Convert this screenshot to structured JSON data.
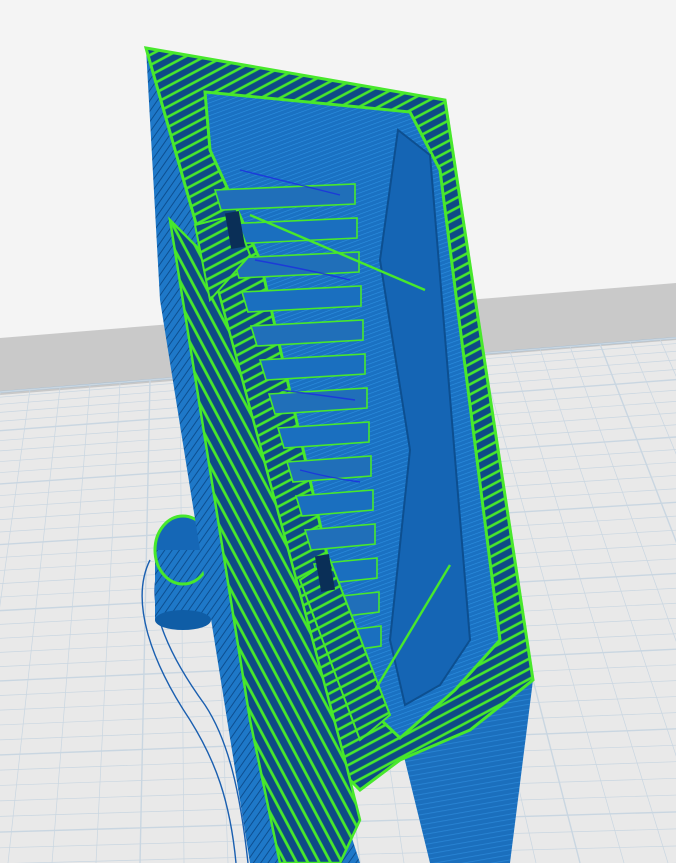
{
  "viewport": {
    "view": "layer-preview",
    "colors": {
      "background": "#f4f4f4",
      "wall": "#c4c4c4",
      "plate": "#e9e9e9",
      "grid_line": "#c9d6e1",
      "plate_edge": "#9fb9cf",
      "model_outer": "#0f5da6",
      "model_shell": "#1e78c8",
      "infill_green": "#48e82c",
      "infill_gap": "#0b3f73",
      "travel_blue": "#1b2de0",
      "skirt": "#1a5fb0"
    },
    "layers": [
      {
        "feature": "outer-wall",
        "color": "#0f5da6"
      },
      {
        "feature": "inner-wall",
        "color": "#48e82c"
      },
      {
        "feature": "infill",
        "color": "#48e82c"
      },
      {
        "feature": "skin",
        "color": "#1e78c8"
      },
      {
        "feature": "travel",
        "color": "#1b2de0"
      },
      {
        "feature": "skirt",
        "color": "#1a5fb0"
      }
    ]
  }
}
